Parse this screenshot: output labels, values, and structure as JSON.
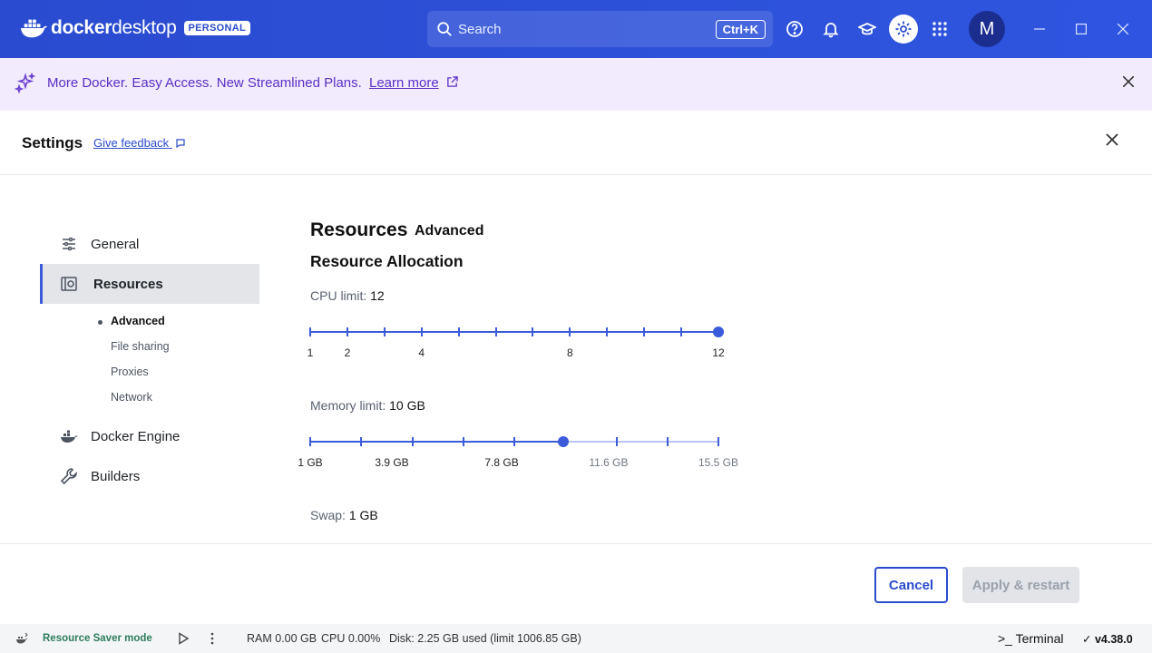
{
  "app": {
    "brand_main": "docker",
    "brand_sub": "desktop",
    "plan_badge": "PERSONAL",
    "search_placeholder": "Search",
    "search_shortcut": "Ctrl+K",
    "avatar_initial": "M"
  },
  "banner": {
    "text": "More Docker. Easy Access. New Streamlined Plans.",
    "link": "Learn more"
  },
  "settings": {
    "title": "Settings",
    "feedback": "Give feedback"
  },
  "sidebar": {
    "items": [
      {
        "label": "General",
        "icon": "sliders-icon"
      },
      {
        "label": "Resources",
        "icon": "resources-icon",
        "selected": true
      },
      {
        "label": "Docker Engine",
        "icon": "docker-engine-icon"
      },
      {
        "label": "Builders",
        "icon": "wrench-icon"
      }
    ],
    "sub_items": [
      {
        "label": "Advanced",
        "active": true
      },
      {
        "label": "File sharing"
      },
      {
        "label": "Proxies"
      },
      {
        "label": "Network"
      }
    ]
  },
  "main": {
    "heading": "Resources",
    "tab": "Advanced",
    "section": "Resource Allocation",
    "cpu": {
      "label": "CPU limit:",
      "value": "12",
      "min": 1,
      "max": 12,
      "current": 12,
      "tick_labels": [
        "1",
        "2",
        "4",
        "8",
        "12"
      ]
    },
    "memory": {
      "label": "Memory limit:",
      "value": "10 GB",
      "min_gb": 1,
      "max_gb": 15.5,
      "current_gb": 10,
      "tick_labels": [
        "1 GB",
        "3.9 GB",
        "7.8 GB",
        "11.6 GB",
        "15.5 GB"
      ]
    },
    "swap": {
      "label": "Swap:",
      "value": "1 GB"
    }
  },
  "actions": {
    "cancel": "Cancel",
    "apply": "Apply & restart"
  },
  "statusbar": {
    "resource_saver": "Resource Saver mode",
    "ram": "RAM 0.00 GB",
    "cpu": "CPU 0.00%",
    "disk": "Disk: 2.25 GB used (limit 1006.85 GB)",
    "terminal": "Terminal",
    "version": "v4.38.0"
  },
  "colors": {
    "brand_blue": "#2a4bd0",
    "accent": "#3b5bdb",
    "banner_bg": "#f1ebfd",
    "banner_text": "#5b2fc6"
  }
}
